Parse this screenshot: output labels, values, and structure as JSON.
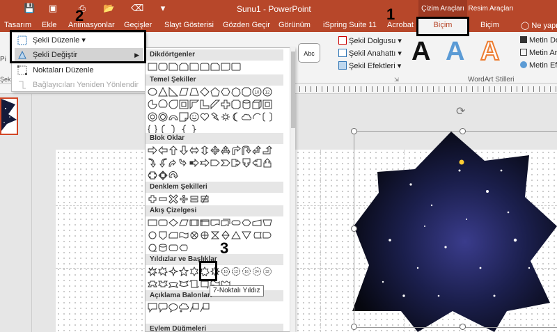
{
  "window": {
    "title": "Sunu1 - PowerPoint",
    "context_cizim": "Çizim Araçları",
    "context_resim": "Resim Araçları"
  },
  "tabs": [
    "Tasarım",
    "Ekle",
    "Animasyonlar",
    "Geçişler",
    "Slayt Gösterisi",
    "Gözden Geçir",
    "Görünüm",
    "iSpring Suite 11",
    "Acrobat"
  ],
  "tab_bicim_active": "Biçim",
  "tab_bicim_resim": "Biçim",
  "help_search": "Ne yapm",
  "ribbon": {
    "abc": "Abc",
    "fill": "Şekil Dolgusu",
    "outline": "Şekil Anahattı",
    "effects": "Şekil Efektleri",
    "wordart_letter": "A",
    "wordart_group": "WordArt Stilleri",
    "text_fill": "Metin Do",
    "text_outline": "Metin Ar",
    "text_effects": "Metin Efe"
  },
  "left_labels": {
    "sekil_e": "Şekil E",
    "pi": "Pi"
  },
  "menu": {
    "edit_shape": "Şekli Düzenle",
    "change_shape": "Şekli Değiştir",
    "edit_points": "Noktaları Düzenle",
    "reroute": "Bağlayıcıları Yeniden Yönlendir"
  },
  "gallery": {
    "categories": [
      "Dikdörtgenler",
      "Temel Şekiller",
      "Blok Oklar",
      "Denklem Şekilleri",
      "Akış Çizelgesi",
      "Yıldızlar ve Başlıklar",
      "Açıklama Balonları",
      "Eylem Düğmeleri"
    ],
    "tooltip": "7-Noktalı Yıldız"
  },
  "annotations": [
    "1",
    "2",
    "3"
  ],
  "colors": {
    "accent": "#b7472a",
    "accent_dark": "#9e3a23",
    "thumb_border": "#d24726"
  }
}
